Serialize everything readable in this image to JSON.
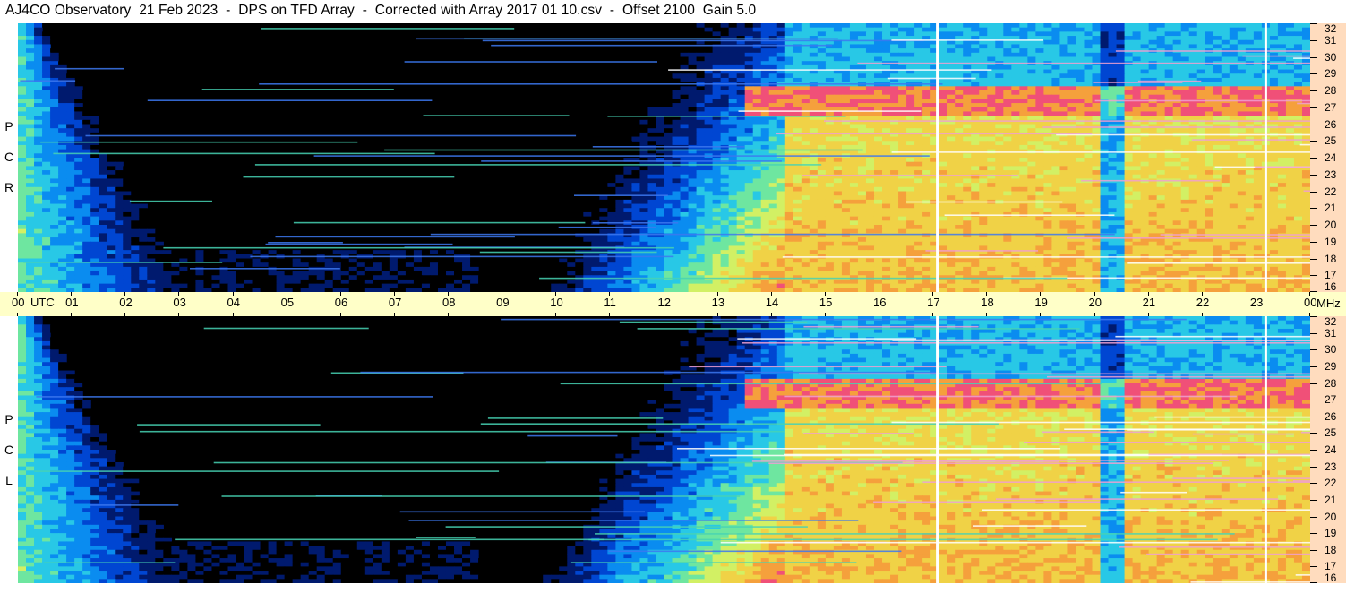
{
  "header": {
    "title": "AJ4CO Observatory  21 Feb 2023  -  DPS on TFD Array  -  Corrected with Array 2017 01 10.csv  -  Offset 2100  Gain 5.0"
  },
  "chart_data": {
    "type": "heatmap",
    "title": "AJ4CO Observatory  21 Feb 2023  -  DPS on TFD Array  -  Corrected with Array 2017 01 10.csv  -  Offset 2100  Gain 5.0",
    "x_axis": {
      "unit": "UTC",
      "ticks": [
        "00",
        "01",
        "02",
        "03",
        "04",
        "05",
        "06",
        "07",
        "08",
        "09",
        "10",
        "11",
        "12",
        "13",
        "14",
        "15",
        "16",
        "17",
        "18",
        "19",
        "20",
        "21",
        "22",
        "23",
        "00"
      ],
      "range": [
        0,
        24
      ]
    },
    "y_axis": {
      "unit": "MHz",
      "ticks": [
        "16",
        "17",
        "18",
        "19",
        "20",
        "21",
        "22",
        "23",
        "24",
        "25",
        "26",
        "27",
        "28",
        "29",
        "30",
        "31",
        "32"
      ],
      "range": [
        16,
        32
      ]
    },
    "panels": [
      {
        "polarization": [
          "R",
          "C",
          "P"
        ]
      },
      {
        "polarization": [
          "L",
          "C",
          "P"
        ]
      }
    ],
    "colormap": [
      "#000000",
      "#001a6e",
      "#0046d2",
      "#0a8cf0",
      "#28c8e6",
      "#6ee6a0",
      "#d2f064",
      "#f0d246",
      "#f5a03c",
      "#f05078",
      "#e63cc8",
      "#ffffff"
    ]
  }
}
